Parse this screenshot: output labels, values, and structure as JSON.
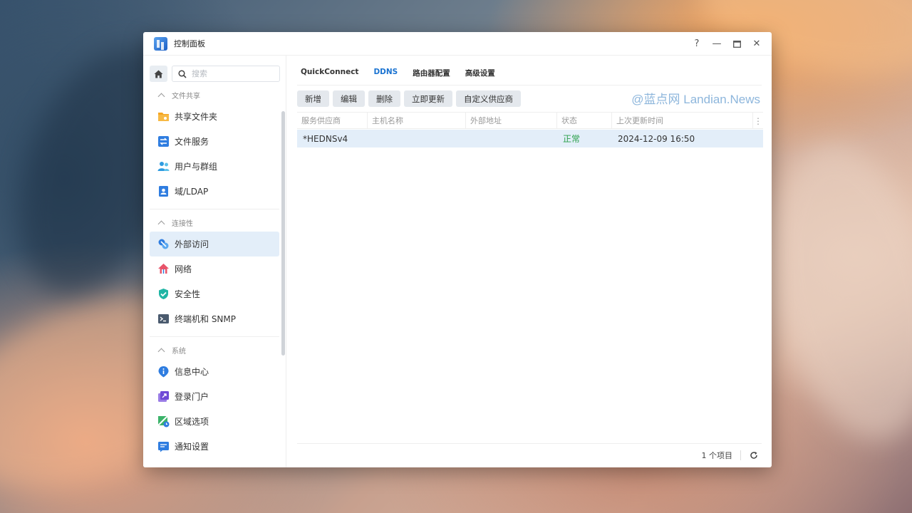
{
  "window": {
    "title": "控制面板",
    "controls": [
      "?",
      "—",
      "▭",
      "✕"
    ]
  },
  "sidebar": {
    "search_placeholder": "搜索",
    "sections": [
      {
        "label": "文件共享",
        "items": [
          {
            "label": "共享文件夹",
            "icon": "shared-folder-icon"
          },
          {
            "label": "文件服务",
            "icon": "file-services-icon"
          },
          {
            "label": "用户与群组",
            "icon": "user-group-icon"
          },
          {
            "label": "域/LDAP",
            "icon": "domain-ldap-icon"
          }
        ]
      },
      {
        "label": "连接性",
        "items": [
          {
            "label": "外部访问",
            "icon": "external-access-icon",
            "active": true
          },
          {
            "label": "网络",
            "icon": "network-icon"
          },
          {
            "label": "安全性",
            "icon": "security-shield-icon"
          },
          {
            "label": "终端机和 SNMP",
            "icon": "terminal-icon"
          }
        ]
      },
      {
        "label": "系统",
        "items": [
          {
            "label": "信息中心",
            "icon": "info-center-icon"
          },
          {
            "label": "登录门户",
            "icon": "login-portal-icon"
          },
          {
            "label": "区域选项",
            "icon": "regional-options-icon"
          },
          {
            "label": "通知设置",
            "icon": "notification-icon"
          }
        ]
      }
    ]
  },
  "tabs": [
    {
      "label": "QuickConnect"
    },
    {
      "label": "DDNS",
      "active": true
    },
    {
      "label": "路由器配置"
    },
    {
      "label": "高级设置"
    }
  ],
  "toolbar": {
    "add": "新增",
    "edit": "编辑",
    "delete": "删除",
    "update_now": "立即更新",
    "custom_provider": "自定义供应商"
  },
  "watermark": "@蓝点网 Landian.News",
  "table": {
    "columns": [
      "服务供应商",
      "主机名称",
      "外部地址",
      "状态",
      "上次更新时间"
    ],
    "rows": [
      {
        "provider": "*HEDNSv4",
        "hostname": "",
        "external_address": "",
        "status": "正常",
        "last_update": "2024-12-09 16:50"
      }
    ]
  },
  "footer": {
    "count": "1 个项目"
  },
  "colors": {
    "accent": "#1a73d1",
    "status_ok": "#2ba04b",
    "selected_row": "#e3eef9"
  }
}
